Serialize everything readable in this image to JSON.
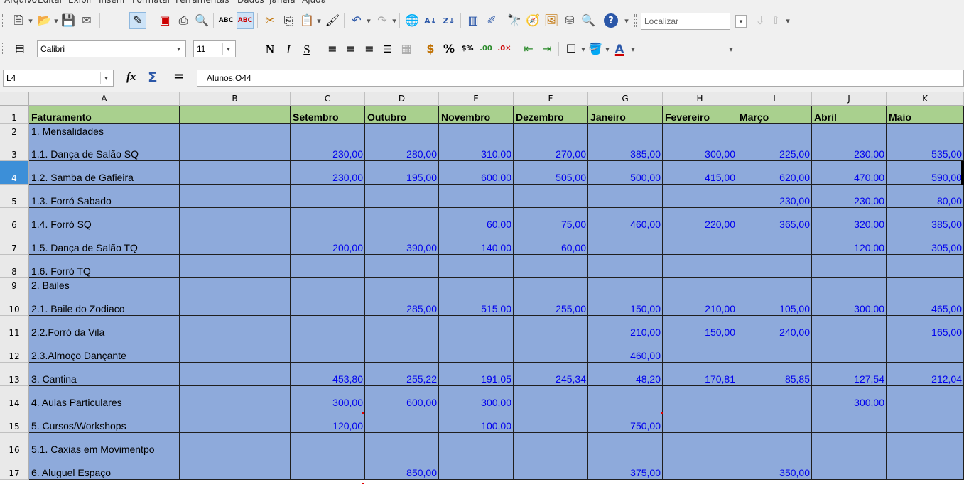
{
  "menu": [
    "Arquivo",
    "Editar",
    "Exibir",
    "Inserir",
    "Formatar",
    "Ferramentas",
    "Dados",
    "Janela",
    "Ajuda"
  ],
  "toolbar": {
    "search_placeholder": "Localizar",
    "font_name": "Calibri",
    "font_size": "11",
    "spelling_label": "ABC",
    "autospell_label": "ABC"
  },
  "formula_bar": {
    "cell_ref": "L4",
    "fx": "fx",
    "sum": "Σ",
    "equals": "=",
    "formula": "=Alunos.O44"
  },
  "sheet": {
    "columns": [
      "A",
      "B",
      "C",
      "D",
      "E",
      "F",
      "G",
      "H",
      "I",
      "J",
      "K"
    ],
    "header_row": [
      "Faturamento",
      "",
      "Setembro",
      "Outubro",
      "Novembro",
      "Dezembro",
      "Janeiro",
      "Fevereiro",
      "Março",
      "Abril",
      "Maio"
    ],
    "rows": [
      {
        "num": "2",
        "label": "1. Mensalidades",
        "values": [
          "",
          "",
          "",
          "",
          "",
          "",
          "",
          "",
          ""
        ]
      },
      {
        "num": "3",
        "label": "1.1. Dança de Salão SQ",
        "values": [
          "230,00",
          "280,00",
          "310,00",
          "270,00",
          "385,00",
          "300,00",
          "225,00",
          "230,00",
          "535,00"
        ]
      },
      {
        "num": "4",
        "label": "1.2. Samba de Gafieira",
        "values": [
          "230,00",
          "195,00",
          "600,00",
          "505,00",
          "500,00",
          "415,00",
          "620,00",
          "470,00",
          "590,00"
        ]
      },
      {
        "num": "5",
        "label": "1.3. Forró Sabado",
        "values": [
          "",
          "",
          "",
          "",
          "",
          "",
          "230,00",
          "230,00",
          "80,00"
        ]
      },
      {
        "num": "6",
        "label": "1.4. Forró SQ",
        "values": [
          "",
          "",
          "60,00",
          "75,00",
          "460,00",
          "220,00",
          "365,00",
          "320,00",
          "385,00"
        ]
      },
      {
        "num": "7",
        "label": "1.5. Dança de Salão TQ",
        "values": [
          "200,00",
          "390,00",
          "140,00",
          "60,00",
          "",
          "",
          "",
          "120,00",
          "305,00"
        ]
      },
      {
        "num": "8",
        "label": "1.6. Forró TQ",
        "values": [
          "",
          "",
          "",
          "",
          "",
          "",
          "",
          "",
          ""
        ]
      },
      {
        "num": "9",
        "label": "2. Bailes",
        "values": [
          "",
          "",
          "",
          "",
          "",
          "",
          "",
          "",
          ""
        ]
      },
      {
        "num": "10",
        "label": "2.1. Baile do Zodiaco",
        "values": [
          "",
          "285,00",
          "515,00",
          "255,00",
          "150,00",
          "210,00",
          "105,00",
          "300,00",
          "465,00"
        ]
      },
      {
        "num": "11",
        "label": "2.2.Forró da Vila",
        "values": [
          "",
          "",
          "",
          "",
          "210,00",
          "150,00",
          "240,00",
          "",
          "165,00"
        ]
      },
      {
        "num": "12",
        "label": "2.3.Almoço Dançante",
        "values": [
          "",
          "",
          "",
          "",
          "460,00",
          "",
          "",
          "",
          ""
        ]
      },
      {
        "num": "13",
        "label": "3. Cantina",
        "values": [
          "453,80",
          "255,22",
          "191,05",
          "245,34",
          "48,20",
          "170,81",
          "85,85",
          "127,54",
          "212,04"
        ]
      },
      {
        "num": "14",
        "label": "4. Aulas Particulares",
        "values": [
          "300,00",
          "600,00",
          "300,00",
          "",
          "",
          "",
          "",
          "300,00",
          ""
        ]
      },
      {
        "num": "15",
        "label": "5. Cursos/Workshops",
        "values": [
          "120,00",
          "",
          "100,00",
          "",
          "750,00",
          "",
          "",
          "",
          ""
        ]
      },
      {
        "num": "16",
        "label": "5.1. Caxias em Movimentpo",
        "values": [
          "",
          "",
          "",
          "",
          "",
          "",
          "",
          "",
          ""
        ]
      },
      {
        "num": "17",
        "label": "6. Aluguel Espaço",
        "values": [
          "",
          "850,00",
          "",
          "",
          "375,00",
          "",
          "350,00",
          "",
          ""
        ]
      }
    ]
  },
  "colors": {
    "cell_blue": "#8eaadb",
    "header_green": "#a9d08e",
    "number_blue": "#0000ee",
    "selected_row_header": "#3c8fd8"
  }
}
